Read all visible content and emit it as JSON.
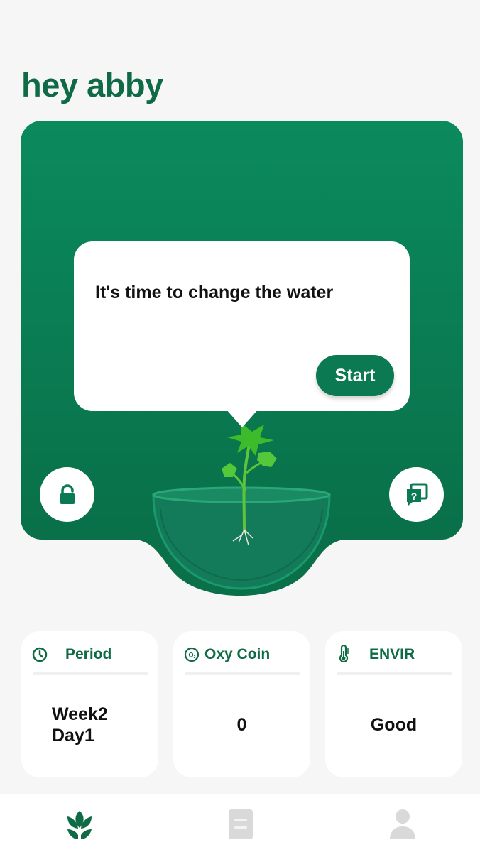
{
  "header": {
    "greeting": "hey abby"
  },
  "hero": {
    "message": "It's time to change the water",
    "start_label": "Start",
    "lock_icon": "lock-icon",
    "help_icon": "help-chat-icon"
  },
  "stats": [
    {
      "icon": "clock-icon",
      "title": "Period",
      "value": "Week2\nDay1"
    },
    {
      "icon": "oxygen-coin-icon",
      "title": "Oxy Coin",
      "value": "0"
    },
    {
      "icon": "thermometer-icon",
      "title": "ENVIR",
      "value": "Good"
    }
  ],
  "nav": {
    "items": [
      {
        "icon": "plant-home-icon",
        "active": true
      },
      {
        "icon": "notes-icon",
        "active": false
      },
      {
        "icon": "profile-icon",
        "active": false
      }
    ]
  },
  "colors": {
    "brand": "#0e6b46",
    "hero_top": "#0b8a5e",
    "hero_bottom": "#097049",
    "background": "#f6f6f6"
  }
}
